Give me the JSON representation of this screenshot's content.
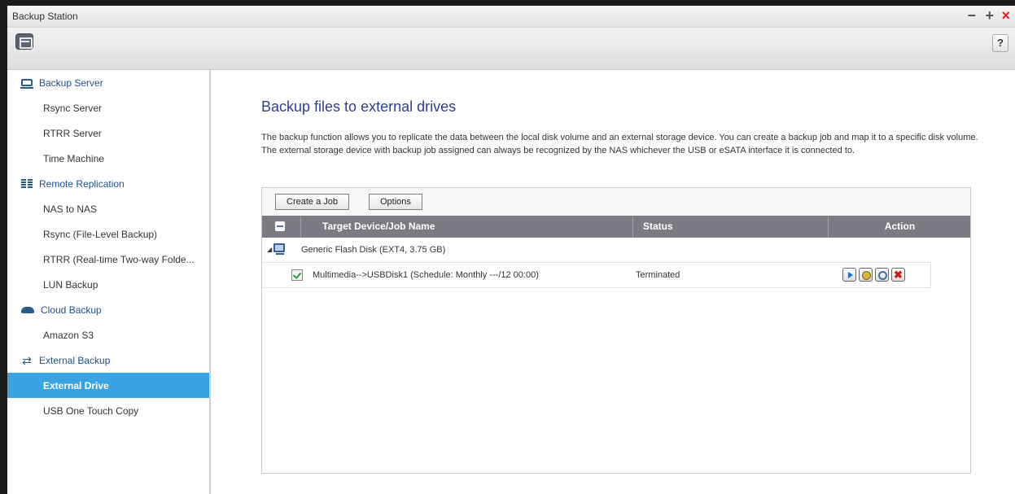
{
  "window": {
    "title": "Backup Station",
    "controls": {
      "minimize": "−",
      "maximize": "+",
      "close": "×"
    },
    "help_label": "?"
  },
  "sidebar": {
    "groups": [
      {
        "label": "Backup Server",
        "icon": "server-icon",
        "items": [
          {
            "label": "Rsync Server"
          },
          {
            "label": "RTRR Server"
          },
          {
            "label": "Time Machine"
          }
        ]
      },
      {
        "label": "Remote Replication",
        "icon": "replication-icon",
        "items": [
          {
            "label": "NAS to NAS"
          },
          {
            "label": "Rsync (File-Level Backup)"
          },
          {
            "label": "RTRR (Real-time Two-way Folde..."
          },
          {
            "label": "LUN Backup"
          }
        ]
      },
      {
        "label": "Cloud Backup",
        "icon": "cloud-icon",
        "items": [
          {
            "label": "Amazon S3"
          }
        ]
      },
      {
        "label": "External Backup",
        "icon": "sync-icon",
        "items": [
          {
            "label": "External Drive",
            "active": true
          },
          {
            "label": "USB One Touch Copy"
          }
        ]
      }
    ]
  },
  "main": {
    "title": "Backup files to external drives",
    "description": "The backup function allows you to replicate the data between the local disk volume and an external storage device. You can create a backup job and map it to a specific disk volume. The external storage device with backup job assigned can always be recognized by the NAS whichever the USB or eSATA interface it is connected to.",
    "toolbar": {
      "create_label": "Create a Job",
      "options_label": "Options"
    },
    "table": {
      "columns": [
        "Target Device/Job Name",
        "Status",
        "Action"
      ],
      "device": {
        "name": "Generic Flash Disk (EXT4, 3.75 GB)",
        "expand": "◢"
      },
      "job": {
        "name": "Multimedia-->USBDisk1 (Schedule: Monthly ---/12 00:00)",
        "status": "Terminated",
        "actions": [
          "play-icon",
          "edit-icon",
          "view-icon",
          "delete-icon"
        ],
        "delete_glyph": "✖"
      }
    }
  }
}
